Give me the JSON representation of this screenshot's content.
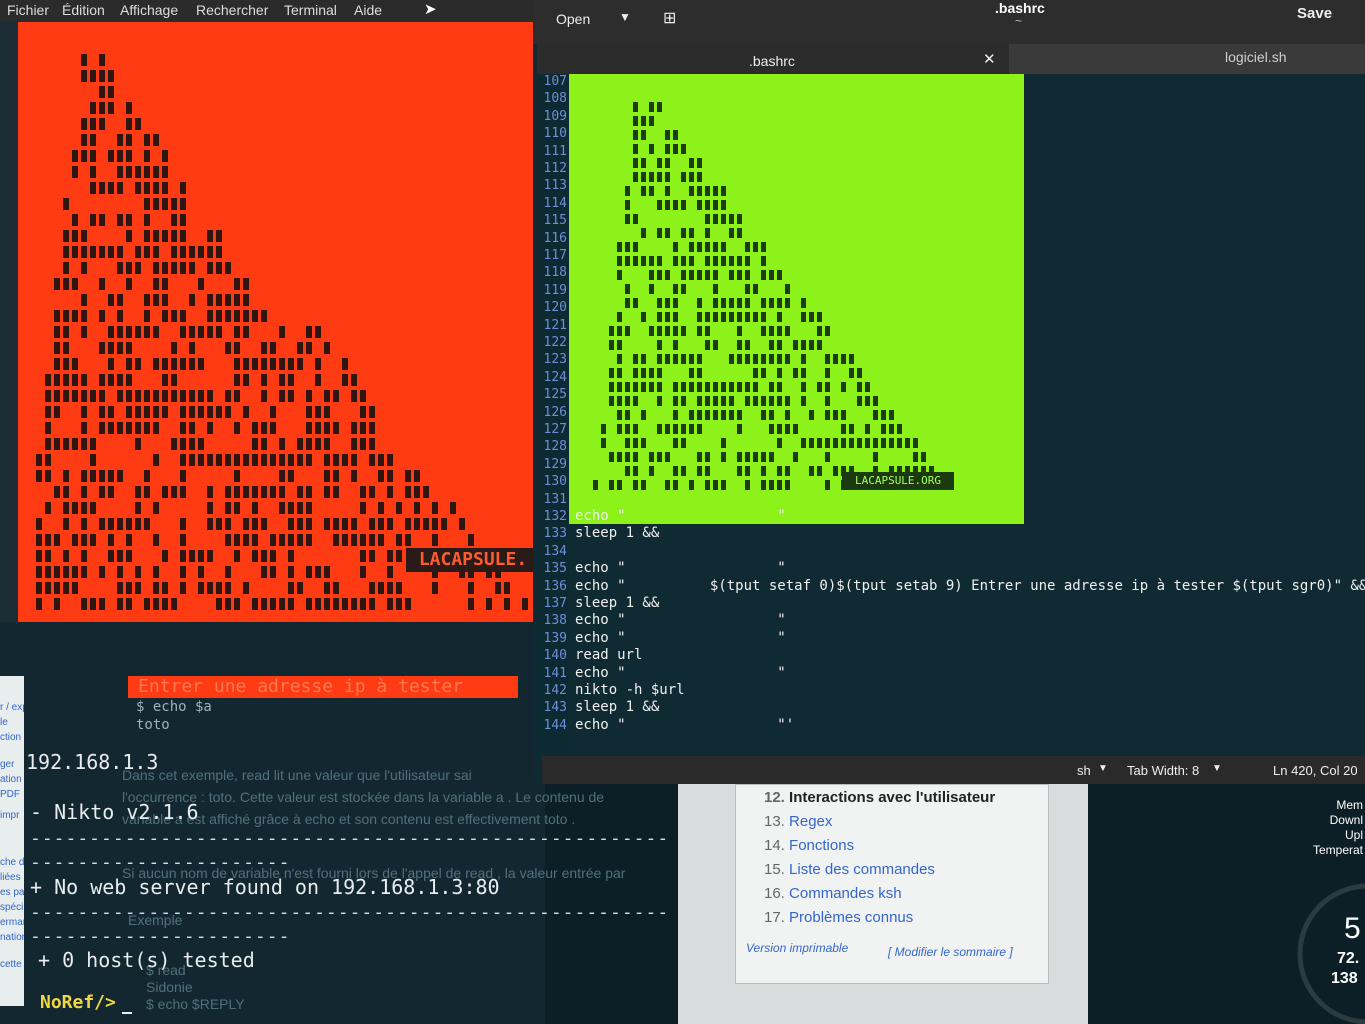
{
  "terminal": {
    "menu": [
      "Fichier",
      "Édition",
      "Affichage",
      "Rechercher",
      "Terminal",
      "Aide"
    ],
    "logo_text": "LACAPSULE.",
    "prompt_text": "Entrer une adresse ip à tester",
    "echo_cmd": "$ echo $a",
    "echo_val": "toto",
    "ip": "192.168.1.3",
    "nikto_version": "- Nikto v2.1.6",
    "dashes": "-----------------------------------------------------------------",
    "dashes_short": "----------------------------",
    "result": "+ No web server found on 192.168.1.3:80",
    "tested": "+ 0 host(s) tested",
    "prompt": "NoRef/>",
    "bg_text": [
      "Dans cet exemple,  read  lit une valeur que l'utilisateur sai",
      "l'occurrence : toto. Cette valeur est stockée dans la variable  a . Le contenu de",
      "variable  a  est affiché grâce à  echo  et son contenu est effectivement  toto .",
      "Si aucun nom de variable n'est fourni lors de l'appel de  read , la valeur entrée par",
      "Exemple",
      "$ read",
      "Sidonie",
      "$ echo $REPLY"
    ],
    "side_fragments": [
      "r / exporter",
      "le",
      "ction",
      "ger",
      "ation",
      "PDF",
      "impr",
      "che d",
      "liées",
      "es pa",
      "spéci",
      "erman",
      "nations",
      "cette p"
    ]
  },
  "editor": {
    "open_label": "Open",
    "title": ".bashrc",
    "subtitle": "~",
    "save_label": "Save",
    "tabs": [
      ".bashrc",
      "logiciel.sh"
    ],
    "art_logo": "LACAPSULE.ORG",
    "lines": [
      {
        "n": "107",
        "t": ""
      },
      {
        "n": "108",
        "t": ""
      },
      {
        "n": "109",
        "t": ""
      },
      {
        "n": "110",
        "t": ""
      },
      {
        "n": "111",
        "t": ""
      },
      {
        "n": "112",
        "t": ""
      },
      {
        "n": "113",
        "t": ""
      },
      {
        "n": "114",
        "t": ""
      },
      {
        "n": "115",
        "t": ""
      },
      {
        "n": "116",
        "t": ""
      },
      {
        "n": "117",
        "t": ""
      },
      {
        "n": "118",
        "t": ""
      },
      {
        "n": "119",
        "t": ""
      },
      {
        "n": "120",
        "t": ""
      },
      {
        "n": "121",
        "t": ""
      },
      {
        "n": "122",
        "t": ""
      },
      {
        "n": "123",
        "t": ""
      },
      {
        "n": "124",
        "t": ""
      },
      {
        "n": "125",
        "t": ""
      },
      {
        "n": "126",
        "t": ""
      },
      {
        "n": "127",
        "t": ""
      },
      {
        "n": "128",
        "t": ""
      },
      {
        "n": "129",
        "t": ""
      },
      {
        "n": "130",
        "t": ""
      },
      {
        "n": "131",
        "t": ""
      },
      {
        "n": "132",
        "t": "echo \"                  \""
      },
      {
        "n": "133",
        "t": "sleep 1 &&"
      },
      {
        "n": "134",
        "t": ""
      },
      {
        "n": "135",
        "t": "echo \"                  \""
      },
      {
        "n": "136",
        "t": "echo \"          $(tput setaf 0)$(tput setab 9) Entrer une adresse ip à tester $(tput sgr0)\" &&"
      },
      {
        "n": "137",
        "t": "sleep 1 &&"
      },
      {
        "n": "138",
        "t": "echo \"                  \""
      },
      {
        "n": "139",
        "t": "echo \"                  \""
      },
      {
        "n": "140",
        "t": "read url"
      },
      {
        "n": "141",
        "t": "echo \"                  \""
      },
      {
        "n": "142",
        "t": "nikto -h $url"
      },
      {
        "n": "143",
        "t": "sleep 1 &&"
      },
      {
        "n": "144",
        "t": "echo \"                  \"'"
      }
    ],
    "status": {
      "lang": "sh",
      "tab_width": "Tab Width: 8",
      "position": "Ln 420, Col 20"
    }
  },
  "wiki": {
    "toc": [
      {
        "num": "12.",
        "label": "Interactions avec l'utilisateur"
      },
      {
        "num": "13.",
        "label": "Regex"
      },
      {
        "num": "14.",
        "label": "Fonctions"
      },
      {
        "num": "15.",
        "label": "Liste des commandes"
      },
      {
        "num": "16.",
        "label": "Commandes ksh"
      },
      {
        "num": "17.",
        "label": "Problèmes connus"
      }
    ],
    "print_label": "Version imprimable",
    "edit_label": "[ Modifier le sommaire ]"
  },
  "sysmon": {
    "labels": [
      "Mem",
      "Downl",
      "Upl",
      "Temperat"
    ],
    "value_big": "5",
    "value1": "72.",
    "value2": "138"
  },
  "colors": {
    "terminal_art": "#ff3b14",
    "editor_art": "#8cf21a",
    "accent_link": "#3366cc"
  }
}
